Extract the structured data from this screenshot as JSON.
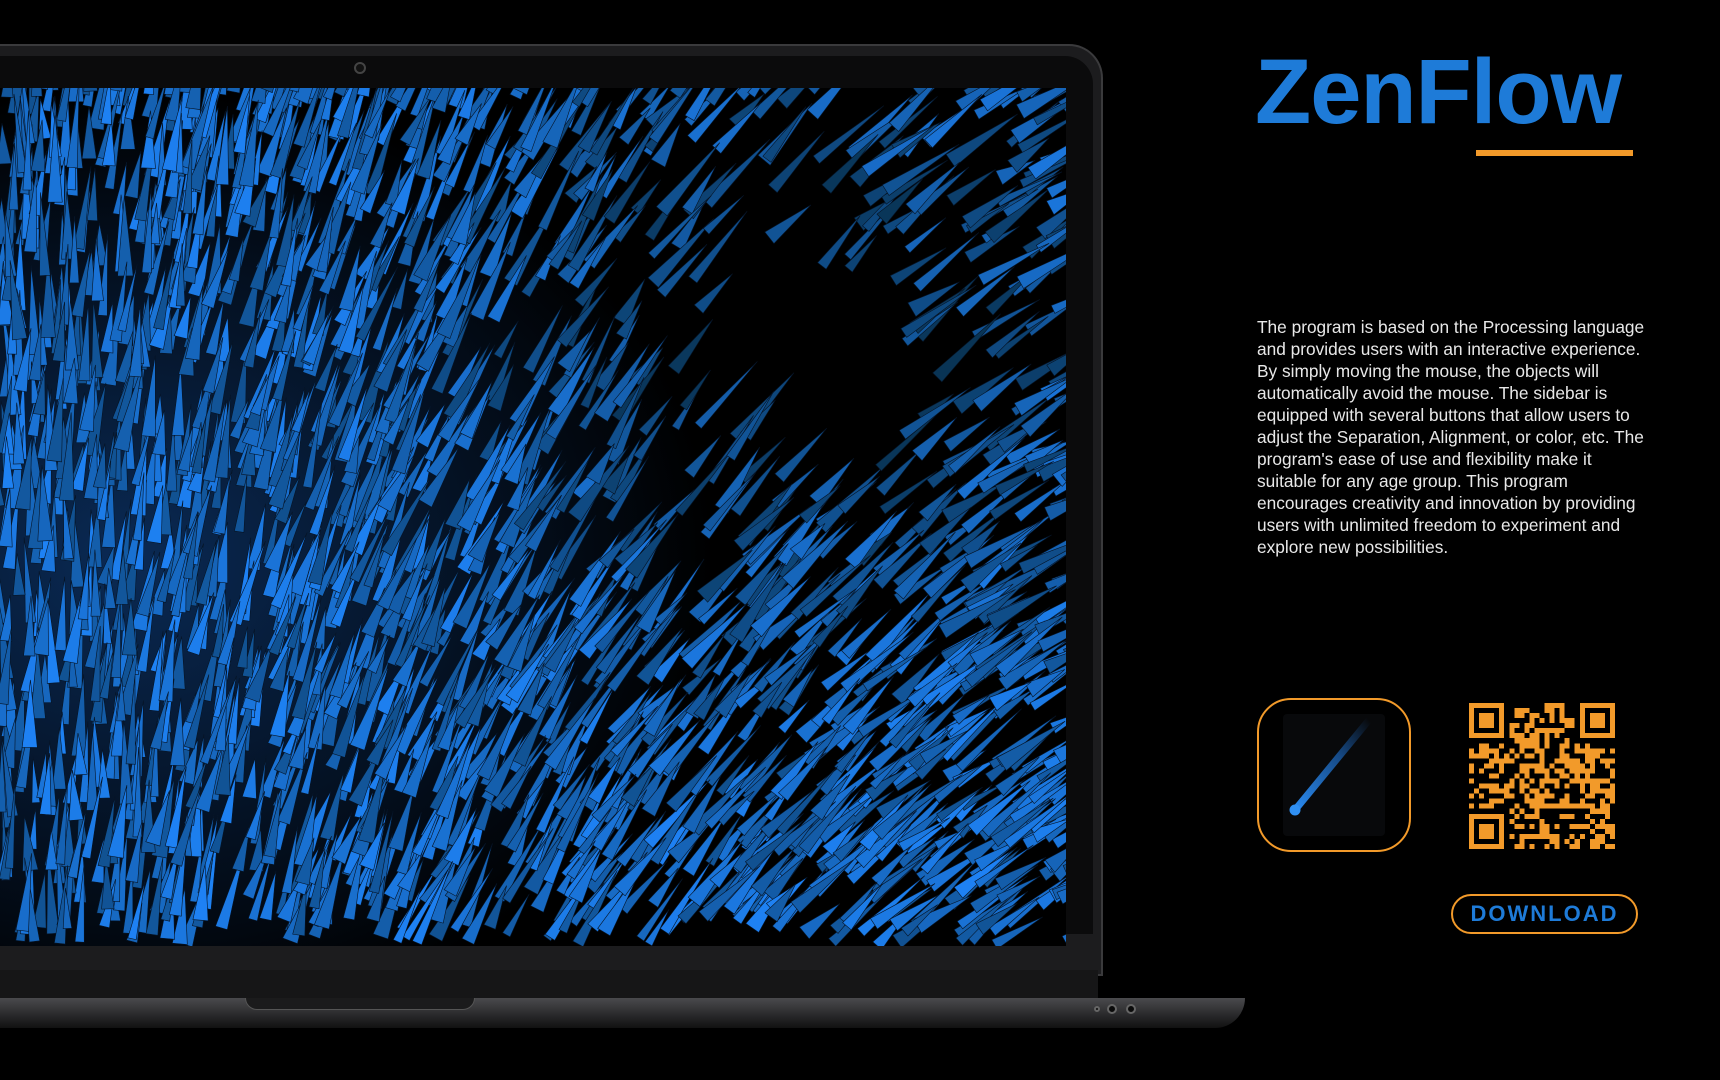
{
  "app": {
    "title": "ZenFlow",
    "description": "The program is based on the Processing language and provides users with an interactive experience. By simply moving the mouse, the objects will automatically avoid the mouse. The sidebar is equipped with several buttons that allow users to adjust the Separation, Alignment, or color, etc. The program's ease of use and flexibility make it suitable for any age group. This program encourages creativity and innovation by providing users with unlimited freedom to experiment and explore new possibilities.",
    "download_label": "DOWNLOAD"
  },
  "colors": {
    "brand_blue": "#1e7bd8",
    "accent_orange": "#f29a2a",
    "background": "#000000",
    "flow_blue": "#2f7ee0"
  },
  "icons": {
    "app_icon": "comet-stroke-icon",
    "qr": "qr-code-icon",
    "camera": "webcam-icon"
  }
}
